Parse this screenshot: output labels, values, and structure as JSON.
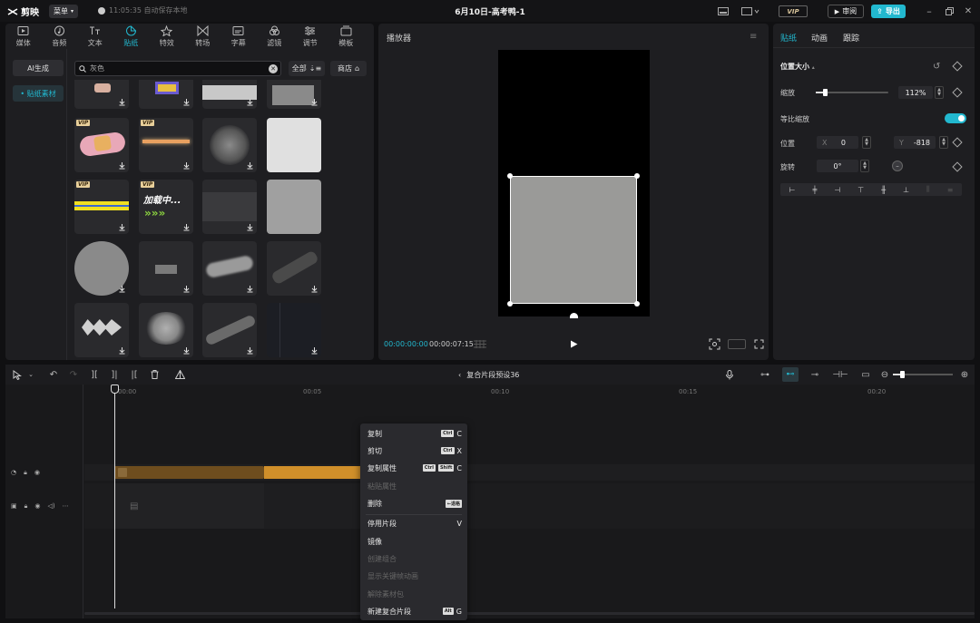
{
  "app": {
    "name": "剪映",
    "menu_label": "菜单",
    "save_status": "11:05:35 自动保存本地",
    "doc_title": "6月10日-高考鸭-1",
    "vip_label": "VIP",
    "review_label": "审阅",
    "export_label": "导出"
  },
  "tabs": [
    {
      "label": "媒体",
      "icon": "media-icon"
    },
    {
      "label": "音频",
      "icon": "audio-icon"
    },
    {
      "label": "文本",
      "icon": "text-icon"
    },
    {
      "label": "贴纸",
      "icon": "sticker-icon",
      "active": true
    },
    {
      "label": "特效",
      "icon": "effects-icon"
    },
    {
      "label": "转场",
      "icon": "transition-icon"
    },
    {
      "label": "字幕",
      "icon": "subtitle-icon"
    },
    {
      "label": "滤镜",
      "icon": "filter-icon"
    },
    {
      "label": "调节",
      "icon": "adjust-icon"
    },
    {
      "label": "模板",
      "icon": "template-icon"
    }
  ],
  "side_nav": {
    "ai_label": "AI生成",
    "material_label": "• 贴纸素材"
  },
  "search": {
    "value": "灰色"
  },
  "filter": {
    "label": "全部",
    "store_label": "商店"
  },
  "sticker_grid": {
    "vip_badge": "VIP",
    "loading_text": "加载中..."
  },
  "player": {
    "title": "播放器",
    "current_time": "00:00:00:00",
    "total_time": "00:00:07:15"
  },
  "inspector": {
    "tabs": [
      "贴纸",
      "动画",
      "跟踪"
    ],
    "section_title": "位置大小",
    "scale_label": "缩放",
    "scale_value": "112%",
    "scale_fraction": 0.12,
    "uniform_label": "等比缩放",
    "position_label": "位置",
    "x_axis": "X",
    "x_value": "0",
    "y_axis": "Y",
    "y_value": "-818",
    "rotate_label": "旋转",
    "rotate_value": "0°"
  },
  "timeline": {
    "compound_title": "复合片段预设36",
    "ticks": [
      "00:00",
      "00:05",
      "00:10",
      "00:15",
      "00:20"
    ],
    "cover_label": "封面"
  },
  "context_menu": [
    {
      "label": "复制",
      "keys": [
        "Ctrl"
      ],
      "key": "C",
      "enabled": true
    },
    {
      "label": "剪切",
      "keys": [
        "Ctrl"
      ],
      "key": "X",
      "enabled": true
    },
    {
      "label": "复制属性",
      "keys": [
        "Ctrl",
        "Shift"
      ],
      "key": "C",
      "enabled": true
    },
    {
      "label": "粘贴属性",
      "keys": [],
      "key": "",
      "enabled": false
    },
    {
      "label": "删除",
      "keys": [
        "←退格"
      ],
      "key": "",
      "enabled": true
    },
    {
      "label": "停用片段",
      "keys": [],
      "key": "V",
      "enabled": true
    },
    {
      "label": "镜像",
      "keys": [],
      "key": "",
      "enabled": true
    },
    {
      "label": "创建组合",
      "keys": [],
      "key": "",
      "enabled": false
    },
    {
      "label": "显示关键帧动画",
      "keys": [],
      "key": "",
      "enabled": false
    },
    {
      "label": "解除素材包",
      "keys": [],
      "key": "",
      "enabled": false
    },
    {
      "label": "新建复合片段",
      "keys": [
        "Alt"
      ],
      "key": "G",
      "enabled": true
    }
  ],
  "colors": {
    "accent": "#22b8cf",
    "clip_dark": "#6e4d1e",
    "clip_light": "#d08f2a",
    "panel": "#1e1e21"
  }
}
